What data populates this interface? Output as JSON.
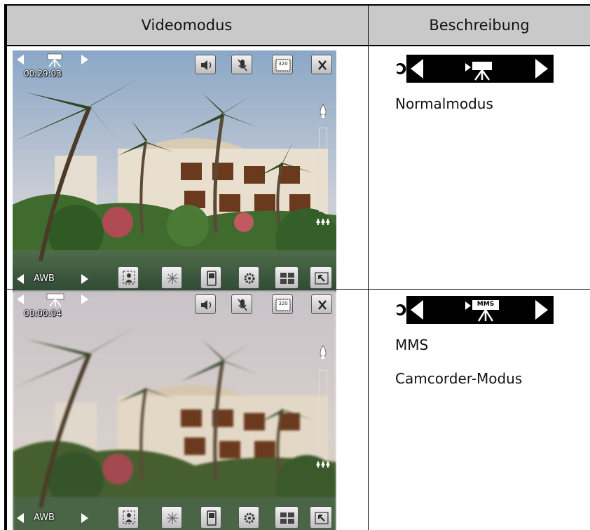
{
  "table": {
    "header_left": "Videomodus",
    "header_right": "Beschreibung"
  },
  "rows": [
    {
      "timer": "00:29:03",
      "awb_label": "AWB",
      "resolution_badge": "320",
      "mode_badge": "",
      "descriptions": [
        "Normalmodus"
      ]
    },
    {
      "timer": "00:00:04",
      "awb_label": "AWB",
      "resolution_badge": "320",
      "mode_badge": "MMS",
      "descriptions": [
        "MMS",
        "Camcorder-Modus"
      ]
    }
  ],
  "icons": {
    "top_bar": [
      "speaker-icon",
      "mic-muted-icon",
      "resolution-icon",
      "close-icon"
    ],
    "bottom_bar": [
      "scene-mode-icon",
      "effects-icon",
      "storage-icon",
      "settings-icon",
      "layout-icon",
      "minimize-icon"
    ],
    "side_bar": [
      "zoom-in-icon",
      "zoom-slider",
      "zoom-out-icon"
    ]
  },
  "colors": {
    "header_bg": "#c9c9c9",
    "border": "#000000",
    "hud_text": "#ffffff",
    "mode_bar_bg": "#000000"
  }
}
